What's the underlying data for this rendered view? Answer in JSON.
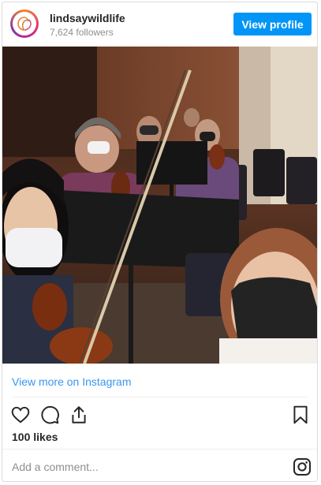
{
  "header": {
    "username": "lindsaywildlife",
    "followers": "7,624 followers",
    "view_profile_label": "View profile"
  },
  "post": {
    "image_description": "orchestra-selfie-photo",
    "view_more_label": "View more on Instagram",
    "likes": "100 likes",
    "comment_placeholder": "Add a comment..."
  },
  "icons": {
    "like": "heart-icon",
    "comment": "comment-icon",
    "share": "share-icon",
    "save": "bookmark-icon",
    "instagram": "instagram-logo-icon"
  },
  "colors": {
    "accent": "#0095f6",
    "link": "#3897f0",
    "text": "#262626",
    "muted": "#8e8e8e"
  }
}
